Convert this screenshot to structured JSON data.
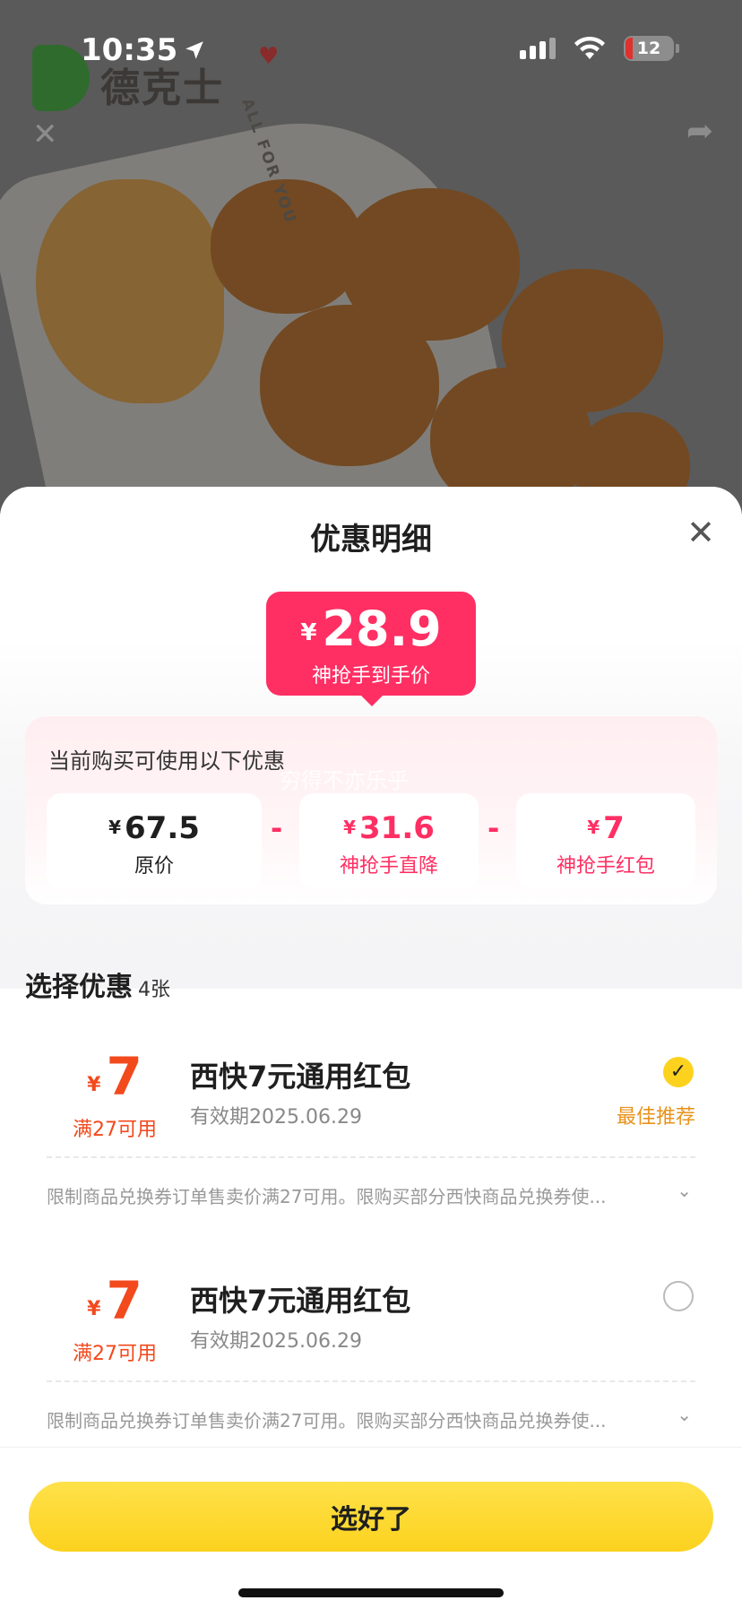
{
  "status_bar": {
    "time": "10:35",
    "battery": "12"
  },
  "hero": {
    "brand_name": "德克士",
    "bucket_text": "ALL FOR YOU"
  },
  "sheet": {
    "title": "优惠明细",
    "final_price": {
      "currency": "¥",
      "amount": "28.9",
      "label": "神抢手到手价"
    },
    "breakdown": {
      "title": "当前购买可使用以下优惠",
      "watermark": "穷得不亦乐乎",
      "items": [
        {
          "currency": "¥",
          "amount": "67.5",
          "label": "原价"
        },
        {
          "currency": "¥",
          "amount": "31.6",
          "label": "神抢手直降"
        },
        {
          "currency": "¥",
          "amount": "7",
          "label": "神抢手红包"
        }
      ],
      "operator": "-"
    },
    "section": {
      "title": "选择优惠",
      "count": "4张"
    },
    "coupons": [
      {
        "currency": "¥",
        "amount": "7",
        "condition": "满27可用",
        "title": "西快7元通用红包",
        "validity": "有效期2025.06.29",
        "selected": true,
        "tag": "最佳推荐",
        "description": "限制商品兑换券订单售卖价满27可用。限购买部分西快商品兑换券使..."
      },
      {
        "currency": "¥",
        "amount": "7",
        "condition": "满27可用",
        "title": "西快7元通用红包",
        "validity": "有效期2025.06.29",
        "selected": false,
        "description": "限制商品兑换券订单售卖价满27可用。限购买部分西快商品兑换券使..."
      }
    ],
    "confirm_label": "选好了"
  },
  "colors": {
    "accent_pink": "#ff2f63",
    "coupon_orange": "#f2491d",
    "button_yellow": "#fcd21e",
    "best_tag": "#e89219"
  }
}
